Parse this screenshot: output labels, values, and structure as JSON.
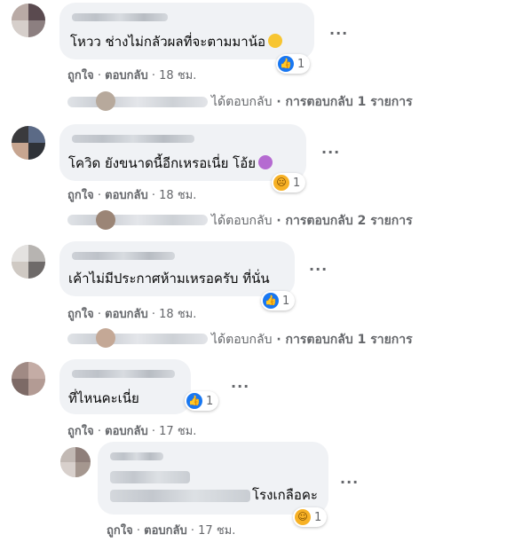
{
  "comments": [
    {
      "text": "โหวว ช่างไม่กลัวผลที่จะตามมาน้อ",
      "reaction_count": "1",
      "like": "ถูกใจ",
      "reply": "ตอบกลับ",
      "time": "18 ชม.",
      "replies_text_a": "ได้ตอบกลับ",
      "replies_text_b": "การตอบกลับ 1 รายการ"
    },
    {
      "text": "โควิด ยังขนาดนี้อีกเหรอเนี่ย โอ้ย",
      "reaction_count": "1",
      "like": "ถูกใจ",
      "reply": "ตอบกลับ",
      "time": "18 ชม.",
      "replies_text_a": "ได้ตอบกลับ",
      "replies_text_b": "การตอบกลับ 2 รายการ"
    },
    {
      "text": "เค้าไม่มีประกาศห้ามเหรอครับ ที่นั่น",
      "reaction_count": "1",
      "like": "ถูกใจ",
      "reply": "ตอบกลับ",
      "time": "18 ชม.",
      "replies_text_a": "ได้ตอบกลับ",
      "replies_text_b": "การตอบกลับ 1 รายการ"
    },
    {
      "text": "ที่ไหนคะเนี่ย",
      "reaction_count": "1",
      "like": "ถูกใจ",
      "reply": "ตอบกลับ",
      "time": "17 ชม."
    }
  ],
  "nested_reply": {
    "text": "โรงเกลือคะ",
    "reaction_count": "1",
    "like": "ถูกใจ",
    "reply": "ตอบกลับ",
    "time": "17 ชม."
  },
  "separator": "·",
  "more_label": "···",
  "colors": {
    "bubble": "#f0f2f5",
    "like_blue": "#1877f2",
    "meta_gray": "#65676b"
  }
}
